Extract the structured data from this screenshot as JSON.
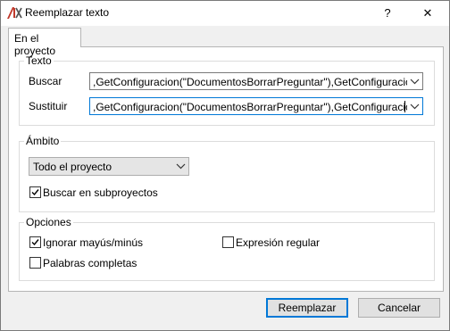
{
  "window": {
    "title": "Reemplazar texto",
    "help_glyph": "?",
    "close_glyph": "✕"
  },
  "tabs": [
    {
      "label": "En el proyecto"
    }
  ],
  "texto": {
    "group_label": "Texto",
    "buscar_label": "Buscar",
    "buscar_value": ",GetConfiguracion(\"DocumentosBorrarPreguntar\"),GetConfiguracion(\"Docu",
    "sustituir_label": "Sustituir",
    "sustituir_value": ",GetConfiguracion(\"DocumentosBorrarPreguntar\"),GetConfiguracion(\"Doc"
  },
  "ambito": {
    "group_label": "Ámbito",
    "scope_selected": "Todo el proyecto",
    "subprojects_label": "Buscar en subproyectos",
    "subprojects_checked": true
  },
  "opciones": {
    "group_label": "Opciones",
    "ignore_case_label": "Ignorar mayús/minús",
    "ignore_case_checked": true,
    "regex_label": "Expresión regular",
    "regex_checked": false,
    "whole_words_label": "Palabras completas",
    "whole_words_checked": false
  },
  "buttons": {
    "replace_label": "Reemplazar",
    "cancel_label": "Cancelar"
  },
  "colors": {
    "focus_accent": "#0078d7",
    "app_icon_red": "#c0392b"
  }
}
